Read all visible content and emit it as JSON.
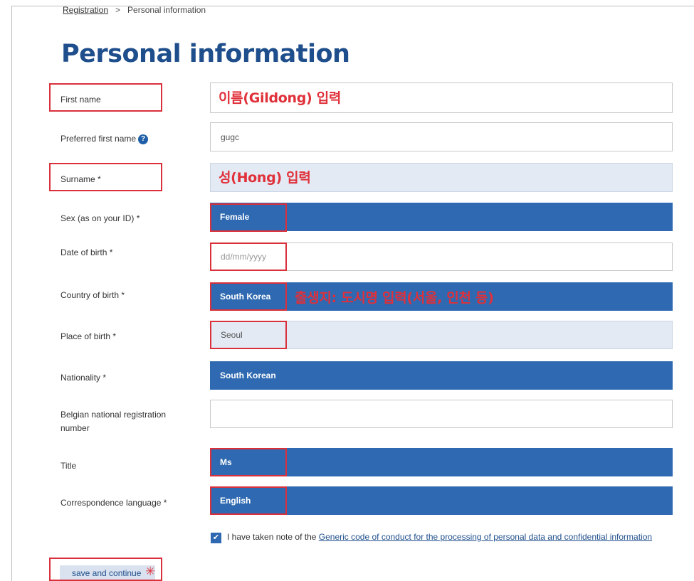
{
  "breadcrumb": {
    "parent": "Registration",
    "separator": ">",
    "current": "Personal information"
  },
  "page_title": "Personal information",
  "fields": {
    "first_name": {
      "label": "First name",
      "value": ""
    },
    "preferred_first_name": {
      "label": "Preferred first name",
      "help_icon": "?",
      "value": "gugc"
    },
    "surname": {
      "label": "Surname *",
      "value": ""
    },
    "sex": {
      "label": "Sex (as on your ID) *",
      "value": "Female"
    },
    "date_of_birth": {
      "label": "Date of birth *",
      "placeholder": "dd/mm/yyyy"
    },
    "country_of_birth": {
      "label": "Country of birth *",
      "value": "South Korea"
    },
    "place_of_birth": {
      "label": "Place of birth *",
      "value": "Seoul"
    },
    "nationality": {
      "label": "Nationality *",
      "value": "South Korean"
    },
    "belgian_registration": {
      "label": "Belgian national registration number",
      "value": ""
    },
    "title": {
      "label": "Title",
      "value": "Ms"
    },
    "correspondence_language": {
      "label": "Correspondence language *",
      "value": "English"
    }
  },
  "annotations": {
    "first_name": "이름(Gildong) 입력",
    "surname": "성(Hong) 입력",
    "country_of_birth": "출생지: 도시명 입력(서울, 인천 등)"
  },
  "consent": {
    "checked": true,
    "prefix": "I have taken note of the",
    "link": "Generic code of conduct for the processing of personal data and confidential information"
  },
  "save_button": "save and continue",
  "colors": {
    "title": "#1f4e8c",
    "select_fill": "#2e69b1",
    "annotation": "#e0303a"
  }
}
